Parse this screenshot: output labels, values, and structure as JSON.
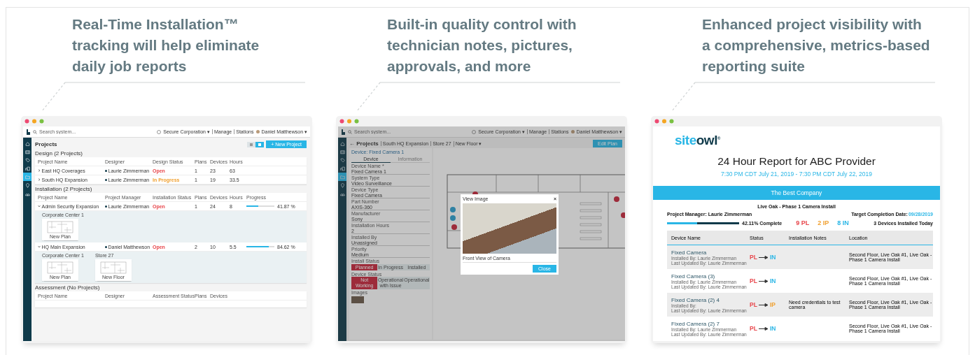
{
  "features": [
    {
      "headline": "Real-Time Installation™ tracking will help eliminate daily job reports",
      "screen": {
        "kind": "projects",
        "topbar": {
          "search_placeholder": "Search system...",
          "organization": "Secure Corporation ▾",
          "links": [
            "Manage",
            "Stations"
          ],
          "user": "Daniel Matthewson ▾"
        },
        "sidebar": [
          {
            "selected": false
          },
          {
            "selected": false
          },
          {
            "selected": false
          },
          {
            "selected": false
          },
          {
            "selected": true
          },
          {
            "selected": false
          },
          {
            "selected": false
          }
        ],
        "title": "Projects",
        "view_toggle": [
          {
            "selected": false
          },
          {
            "selected": true
          }
        ],
        "new_button": "+ New Project",
        "sections": [
          {
            "title": "Design (2 Projects)",
            "columns": [
              "Project Name",
              "Designer",
              "Design Status",
              "Plans",
              "Devices",
              "Hours"
            ],
            "rows": [
              {
                "expanded": false,
                "name": "East HQ Coverages",
                "person": "Laurie Zimmerman",
                "status": {
                  "text": "Open",
                  "color": "#e8474c"
                },
                "values": [
                  "1",
                  "23",
                  "63"
                ]
              },
              {
                "expanded": false,
                "name": "South HQ Expansion",
                "person": "Laurie Zimmerman",
                "status": {
                  "text": "In Progress",
                  "color": "#f0a030"
                },
                "values": [
                  "1",
                  "19",
                  "33.5"
                ]
              }
            ]
          },
          {
            "title": "Installation (2 Projects)",
            "columns": [
              "Project Name",
              "Project Manager",
              "Installation Status",
              "Plans",
              "Devices",
              "Hours",
              "Progress"
            ],
            "rows": [
              {
                "expanded": true,
                "name": "Admin Security Expansion",
                "person": "Laurie Zimmerman",
                "status": {
                  "text": "Open",
                  "color": "#e8474c"
                },
                "values": [
                  "1",
                  "24",
                  "8"
                ],
                "progress": {
                  "level": 0.42,
                  "reading": "41.87 %"
                },
                "sites": [
                  {
                    "name": "Corporate Center 1",
                    "plans": [
                      "New Plan"
                    ]
                  }
                ]
              },
              {
                "expanded": true,
                "name": "HQ Main Expansion",
                "person": "Daniel Matthewson",
                "status": {
                  "text": "Open",
                  "color": "#e8474c"
                },
                "values": [
                  "2",
                  "10",
                  "5.5"
                ],
                "progress": {
                  "level": 0.81,
                  "reading": "84.62 %"
                },
                "sites": [
                  {
                    "name": "Corporate Center 1",
                    "plans": [
                      "New Plan"
                    ]
                  },
                  {
                    "name": "Store 27",
                    "plans": [
                      "New Floor"
                    ]
                  }
                ]
              }
            ]
          },
          {
            "title": "Assessment (No Projects)",
            "columns": [
              "Project Name",
              "Designer",
              "Assessment Status",
              "Plans",
              "Devices"
            ]
          }
        ]
      }
    },
    {
      "headline": "Built-in quality control with technician notes, pictures, approvals, and more",
      "screen": {
        "kind": "plan_editor",
        "topbar": {
          "search_placeholder": "Search system...",
          "organization": "Secure Corporation ▾",
          "links": [
            "Manage",
            "Stations"
          ],
          "user": "Daniel Matthewson ▾"
        },
        "sidebar": [
          {
            "selected": false
          },
          {
            "selected": false
          },
          {
            "selected": false
          },
          {
            "selected": false
          },
          {
            "selected": true
          },
          {
            "selected": false
          },
          {
            "selected": false
          }
        ],
        "back": "← Projects",
        "breadcrumbs": [
          "South HQ Expansion",
          "Store 27",
          "New Floor ▾"
        ],
        "edit_button": "Edit Plan",
        "device_title": "Device: Fixed Camera 1",
        "tabs": [
          {
            "label": "Device",
            "selected": true
          },
          {
            "label": "Information",
            "selected": false
          }
        ],
        "fields": [
          {
            "label": "Device Name *",
            "value": "Fixed Camera 1"
          },
          {
            "label": "System Type",
            "value": "Video Surveillance"
          },
          {
            "label": "Device Type",
            "value": "Fixed Camera"
          },
          {
            "label": "Part Number",
            "value": "AXIS-360"
          },
          {
            "label": "Manufacturer",
            "value": "Sony"
          },
          {
            "label": "Installation Hours",
            "value": "2"
          },
          {
            "label": "Installed By",
            "value": "Unassigned"
          },
          {
            "label": "Priority",
            "value": "Medium"
          }
        ],
        "status_groups": [
          {
            "label": "Install Status",
            "options": [
              {
                "label": "Planned",
                "selected": true
              },
              {
                "label": "In Progress",
                "selected": false
              },
              {
                "label": "Installed",
                "selected": false
              }
            ]
          },
          {
            "label": "Device Status",
            "options": [
              {
                "label": "Not Working",
                "selected": true
              },
              {
                "label": "Operational with Issue",
                "selected": false
              },
              {
                "label": "Operational",
                "selected": false
              }
            ]
          }
        ],
        "images_label": "Images",
        "modal": {
          "title": "View Image",
          "close": "×",
          "caption": "Front View of Camera",
          "button": "Close"
        }
      }
    },
    {
      "headline": "Enhanced project visibility with a comprehensive, metrics-based reporting suite",
      "screen": {
        "kind": "report",
        "logo": {
          "part_1": "site",
          "part_2": "owl",
          "mark": "®"
        },
        "title": "24 Hour Report for ABC Provider",
        "period": "7:30 PM CDT July 21, 2019 - 7:30 PM CDT July 22, 2019",
        "company": "The Best Company",
        "project": "Live Oak - Phase 1 Camera Install",
        "manager": "Project Manager: Laurie Zimmerman",
        "target_label": "Target Completion Date:",
        "target_date": "09/28/2019",
        "progress": {
          "level": 0.42,
          "reading": "42.11% Complete"
        },
        "counts": [
          {
            "text": "9 PL",
            "color": "#e8474c"
          },
          {
            "text": "2 IP",
            "color": "#f0a030"
          },
          {
            "text": "8 IN",
            "color": "#29b6e6"
          }
        ],
        "installed_today": "3 Devices Installed Today",
        "columns": [
          "Device Name",
          "Status",
          "Installation Notes",
          "Location"
        ],
        "rows": [
          {
            "name": "Fixed Camera",
            "installed_by": "Installed By: Laurie Zimmerman",
            "updated_by": "Last Updated By: Laurie Zimmerman",
            "from": {
              "text": "PL",
              "color": "#e8474c"
            },
            "to": {
              "text": "IN",
              "color": "#29b6e6"
            },
            "notes": "",
            "location": "Second Floor, Live Oak #1, Live Oak - Phase 1 Camera Install"
          },
          {
            "name": "Fixed Camera (3)",
            "installed_by": "Installed By: Laurie Zimmerman",
            "updated_by": "Last Updated By: Laurie Zimmerman",
            "from": {
              "text": "PL",
              "color": "#e8474c"
            },
            "to": {
              "text": "IN",
              "color": "#29b6e6"
            },
            "notes": "",
            "location": "Second Floor, Live Oak #1, Live Oak - Phase 1 Camera Install"
          },
          {
            "name": "Fixed Camera (2) 4",
            "installed_by": "Installed By:",
            "updated_by": "Last Updated By: Laurie Zimmerman",
            "from": {
              "text": "PL",
              "color": "#e8474c"
            },
            "to": {
              "text": "IP",
              "color": "#f0a030"
            },
            "notes": "Need credentials to test camera",
            "location": "Second Floor, Live Oak #1, Live Oak - Phase 1 Camera Install"
          },
          {
            "name": "Fixed Camera (2) 7",
            "installed_by": "Installed By: Laurie Zimmerman",
            "updated_by": "Last Updated By: Laurie Zimmerman",
            "from": {
              "text": "PL",
              "color": "#e8474c"
            },
            "to": {
              "text": "IN",
              "color": "#29b6e6"
            },
            "notes": "",
            "location": "Second Floor, Live Oak #1, Live Oak - Phase 1 Camera Install"
          }
        ]
      }
    }
  ]
}
